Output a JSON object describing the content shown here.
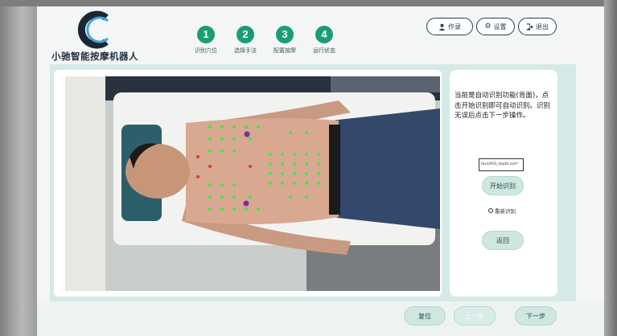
{
  "app": {
    "title": "小驰智能按摩机器人"
  },
  "steps": [
    {
      "num": "1",
      "label": "识别穴位"
    },
    {
      "num": "2",
      "label": "选择手法"
    },
    {
      "num": "3",
      "label": "配置按摩"
    },
    {
      "num": "4",
      "label": "运行状态"
    }
  ],
  "header_buttons": {
    "user": "作录",
    "settings": "设置",
    "logout": "退出"
  },
  "side_panel": {
    "instruction": "当前是自动识别功能(背面)，点击开始识别即可自动识别。识别无误后点击下一步操作。",
    "file_value": "face/ROI_depth.aim*",
    "start_button": "开始识别",
    "reidentify_option": "重新识别",
    "back_button": "返回"
  },
  "bottom_bar": {
    "reset": "复位",
    "prev": "上一步",
    "next": "下一步"
  },
  "colors": {
    "step_green": "#1c9c76",
    "panel_bg": "#d5eae6",
    "button_bg": "#cfe6e1",
    "acupoint_green": "#4fe04f",
    "acupoint_red": "#d63a3a",
    "acupoint_purple": "#7a2fa0"
  },
  "icons": {
    "user": "user-icon",
    "settings": "gear-icon",
    "logout": "logout-icon"
  }
}
